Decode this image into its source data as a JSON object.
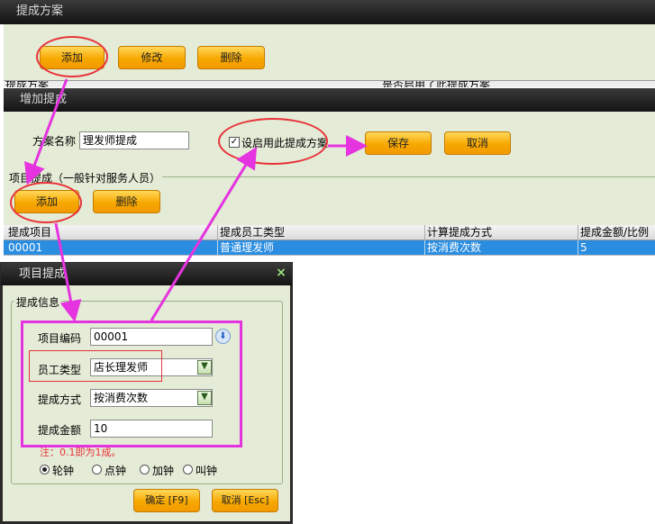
{
  "win1": {
    "title": "提成方案",
    "add": "添加",
    "edit": "修改",
    "delete": "删除",
    "col1": "提成方案",
    "col2": "是否启用了此提成方案"
  },
  "win2": {
    "title": "增加提成",
    "name_label": "方案名称",
    "name_value": "理发师提成",
    "enable_label": "设启用此提成方案",
    "save": "保存",
    "cancel": "取消",
    "group_label": "项目提成（一般针对服务人员）",
    "add": "添加",
    "delete": "删除",
    "columns": [
      "提成项目",
      "提成员工类型",
      "计算提成方式",
      "提成金额/比例"
    ],
    "row": [
      "00001",
      "普通理发师",
      "按消费次数",
      "5"
    ]
  },
  "dialog": {
    "title": "项目提成",
    "close": "×",
    "group_label": "提成信息",
    "code_label": "项目编码",
    "code_value": "00001",
    "emp_label": "员工类型",
    "emp_value": "店长理发师",
    "method_label": "提成方式",
    "method_value": "按消费次数",
    "amount_label": "提成金额",
    "amount_value": "10",
    "note": "注：0.1即为1成。",
    "radios": [
      "轮钟",
      "点钟",
      "加钟",
      "叫钟"
    ],
    "ok": "确定 [F9]",
    "cancel": "取消 [Esc]"
  },
  "colors": {
    "annotation_red": "#e8333a",
    "annotation_magenta": "#e533e0",
    "button_orange": "#f7a800",
    "selected_row": "#2b8de0"
  }
}
